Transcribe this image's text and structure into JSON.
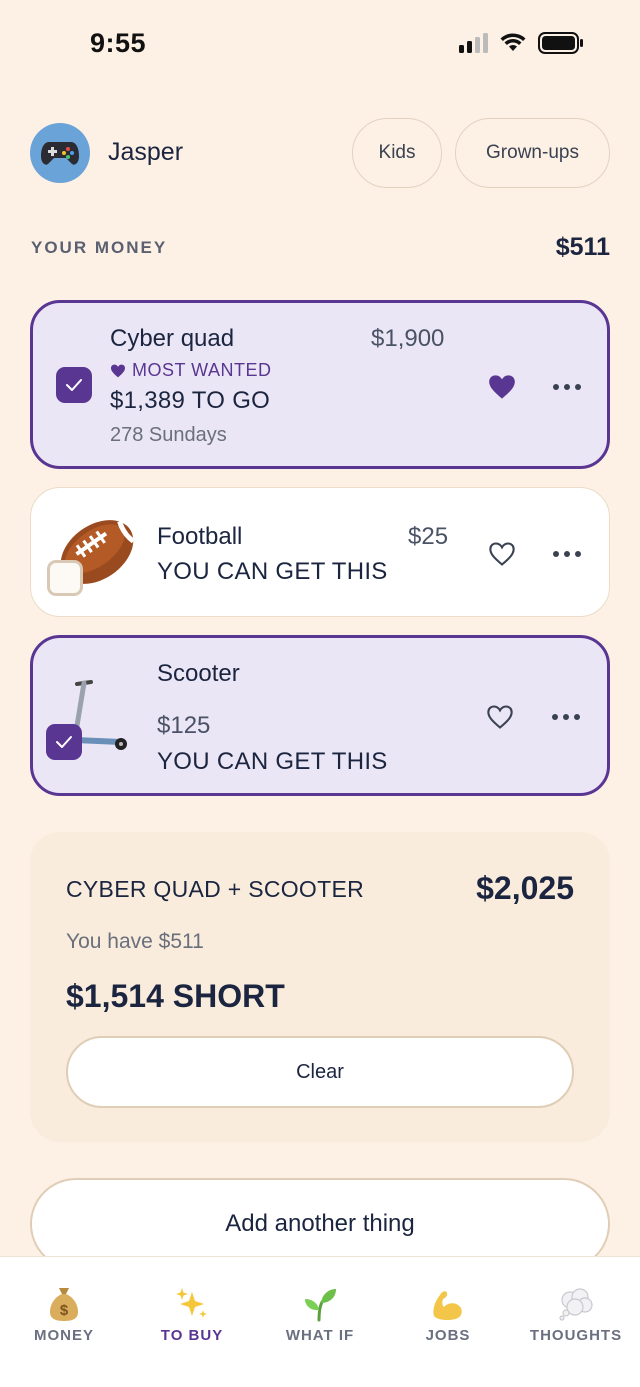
{
  "status_bar": {
    "time": "9:55"
  },
  "profile": {
    "name": "Jasper",
    "avatar_icon": "gamepad-icon"
  },
  "mode_switch": {
    "kids_label": "Kids",
    "grownups_label": "Grown-ups"
  },
  "money": {
    "label": "YOUR MONEY",
    "value": "$511"
  },
  "items": [
    {
      "name": "Cyber quad",
      "price": "$1,900",
      "tag": "MOST WANTED",
      "status": "$1,389 TO GO",
      "sub": "278 Sundays",
      "selected": true,
      "favorited": true
    },
    {
      "name": "Football",
      "price": "$25",
      "status": "YOU CAN GET THIS",
      "selected": false,
      "favorited": false
    },
    {
      "name": "Scooter",
      "price": "$125",
      "status": "YOU CAN GET THIS",
      "selected": true,
      "favorited": false
    }
  ],
  "summary": {
    "title": "CYBER QUAD + SCOOTER",
    "total": "$2,025",
    "have": "You have $511",
    "short": "$1,514 SHORT",
    "clear_label": "Clear"
  },
  "add_label": "Add another thing",
  "tabs": [
    {
      "label": "MONEY",
      "icon": "money-bag-icon",
      "active": false
    },
    {
      "label": "TO BUY",
      "icon": "sparkles-icon",
      "active": true
    },
    {
      "label": "WHAT IF",
      "icon": "seedling-icon",
      "active": false
    },
    {
      "label": "JOBS",
      "icon": "flexed-arm-icon",
      "active": false
    },
    {
      "label": "THOUGHTS",
      "icon": "thought-bubble-icon",
      "active": false
    }
  ],
  "colors": {
    "accent": "#5a3693",
    "background": "#fdf1e6",
    "selected_card": "#ebe6f5"
  }
}
